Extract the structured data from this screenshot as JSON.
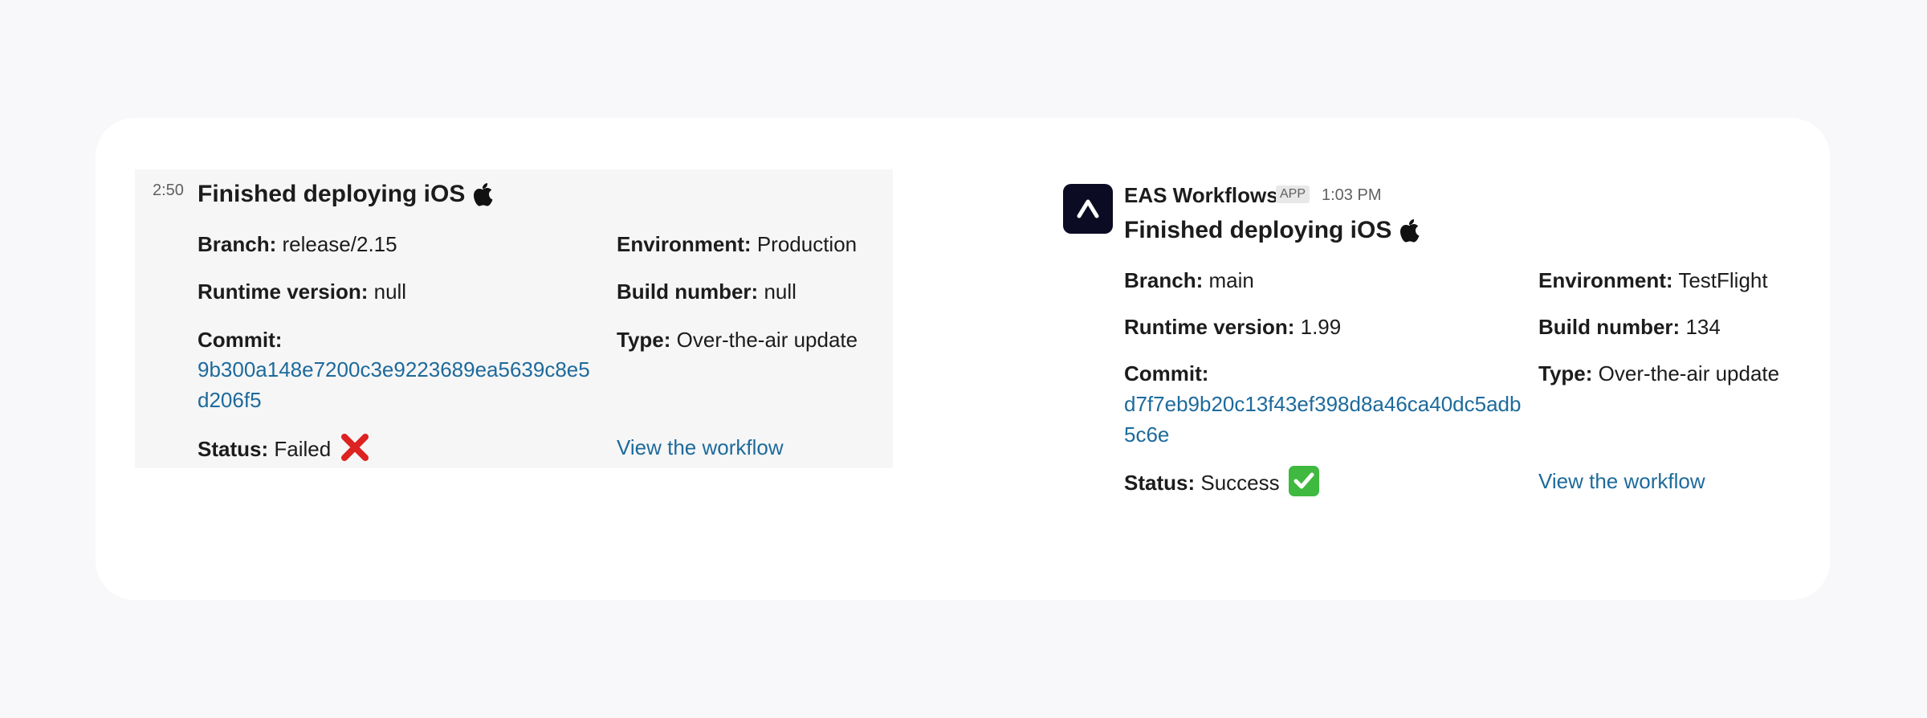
{
  "left_message": {
    "timestamp": "2:50",
    "title": "Finished deploying iOS",
    "branch_label": "Branch:",
    "branch_value": "release/2.15",
    "environment_label": "Environment:",
    "environment_value": "Production",
    "runtime_label": "Runtime version:",
    "runtime_value": "null",
    "build_label": "Build number:",
    "build_value": "null",
    "commit_label": "Commit:",
    "commit_value": "9b300a148e7200c3e9223689ea5639c8e5d206f5",
    "type_label": "Type:",
    "type_value": "Over-the-air update",
    "status_label": "Status:",
    "status_value": "Failed",
    "workflow_link": "View the workflow"
  },
  "right_message": {
    "app_name": "EAS Workflows",
    "app_badge": "APP",
    "timestamp": "1:03 PM",
    "title": "Finished deploying iOS",
    "branch_label": "Branch:",
    "branch_value": "main",
    "environment_label": "Environment:",
    "environment_value": "TestFlight",
    "runtime_label": "Runtime version:",
    "runtime_value": "1.99",
    "build_label": "Build number:",
    "build_value": "134",
    "commit_label": "Commit:",
    "commit_value": "d7f7eb9b20c13f43ef398d8a46ca40dc5adb5c6e",
    "type_label": "Type:",
    "type_value": "Over-the-air update",
    "status_label": "Status:",
    "status_value": "Success",
    "workflow_link": "View the workflow"
  },
  "icons": {
    "apple": "apple-logo-icon",
    "failed": "red-cross-icon",
    "success": "green-check-icon",
    "avatar": "expo-logo-icon"
  },
  "colors": {
    "link": "#1d6a9c",
    "failed": "#dd2222",
    "success": "#3fb93f",
    "avatar_bg": "#0b0b24"
  }
}
